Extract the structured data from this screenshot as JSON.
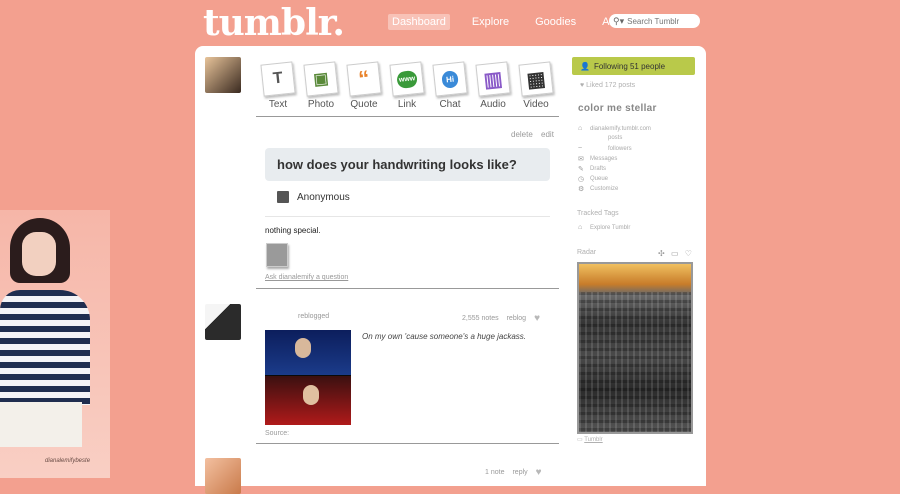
{
  "header": {
    "logo": "tumblr.",
    "nav": [
      {
        "label": "Dashboard",
        "active": true
      },
      {
        "label": "Explore",
        "active": false
      },
      {
        "label": "Goodies",
        "active": false
      },
      {
        "label": "Account",
        "active": false
      }
    ],
    "search_placeholder": "Search Tumblr"
  },
  "left_photo": {
    "signature": "dianalemifybeste"
  },
  "post_types": [
    {
      "label": "Text",
      "icon": "text-icon"
    },
    {
      "label": "Photo",
      "icon": "photo-icon"
    },
    {
      "label": "Quote",
      "icon": "quote-icon"
    },
    {
      "label": "Link",
      "icon": "link-icon"
    },
    {
      "label": "Chat",
      "icon": "chat-icon"
    },
    {
      "label": "Audio",
      "icon": "audio-icon"
    },
    {
      "label": "Video",
      "icon": "video-icon"
    }
  ],
  "post_type_glyphs": [
    "T",
    "▣",
    "“",
    "www",
    "Hi",
    "▥",
    "▦"
  ],
  "ask_post": {
    "delete_label": "delete",
    "edit_label": "edit",
    "question": "how does your handwriting looks like?",
    "asker": "Anonymous",
    "answer": "nothing special.",
    "ask_link": "Ask dianalemify a question"
  },
  "reblog_post": {
    "reblogged_label": "reblogged",
    "notes": "2,555 notes",
    "reblog_label": "reblog",
    "caption": "On my own 'cause someone's a huge jackass.",
    "source_label": "Source:"
  },
  "third_post": {
    "notes": "1 note",
    "reply_label": "reply"
  },
  "sidebar": {
    "following": "Following 51 people",
    "liked": "Liked 172 posts",
    "blog_title": "color me stellar",
    "blog_links": [
      {
        "label": "dianalemify.tumblr.com",
        "icon": "home-icon"
      },
      {
        "label": "posts",
        "icon": "posts-icon"
      },
      {
        "label": "followers",
        "icon": "followers-icon"
      },
      {
        "label": "Messages",
        "icon": "messages-icon"
      },
      {
        "label": "Drafts",
        "icon": "drafts-icon"
      },
      {
        "label": "Queue",
        "icon": "queue-icon"
      },
      {
        "label": "Customize",
        "icon": "customize-icon"
      }
    ],
    "tracked_tags_label": "Tracked Tags",
    "explore_link": "Explore Tumblr",
    "radar_label": "Radar",
    "radar_credit": "Tumblr"
  },
  "colors": {
    "background": "#f3a08f",
    "follow_banner": "#b9c94a",
    "question_bubble": "#e8ecef"
  }
}
